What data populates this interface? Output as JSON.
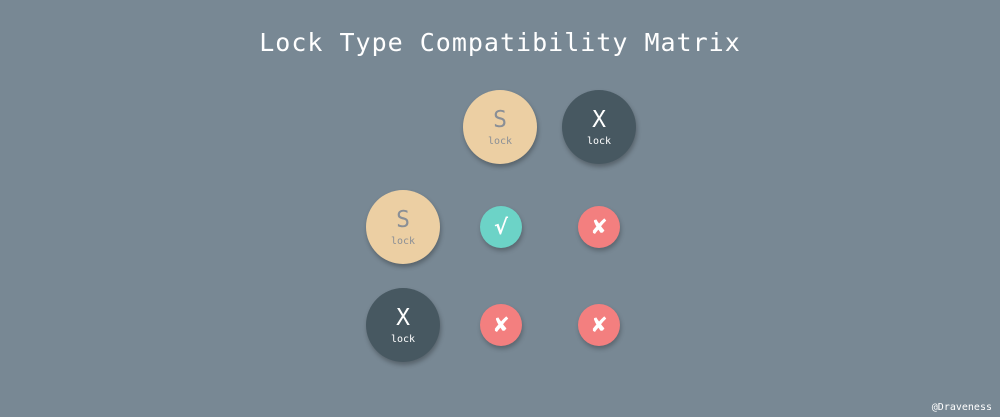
{
  "title": "Lock Type Compatibility Matrix",
  "colors": {
    "background": "#788894",
    "s_lock": "#eccfa3",
    "x_lock": "#475861",
    "compatible": "#6cd3c7",
    "incompatible": "#f37f7f"
  },
  "columns": [
    {
      "letter": "S",
      "sub": "lock",
      "type": "shared"
    },
    {
      "letter": "X",
      "sub": "lock",
      "type": "exclusive"
    }
  ],
  "rows": [
    {
      "letter": "S",
      "sub": "lock",
      "type": "shared"
    },
    {
      "letter": "X",
      "sub": "lock",
      "type": "exclusive"
    }
  ],
  "matrix": [
    [
      {
        "mark": "√",
        "compatible": true
      },
      {
        "mark": "✘",
        "compatible": false
      }
    ],
    [
      {
        "mark": "✘",
        "compatible": false
      },
      {
        "mark": "✘",
        "compatible": false
      }
    ]
  ],
  "credit": "@Draveness"
}
